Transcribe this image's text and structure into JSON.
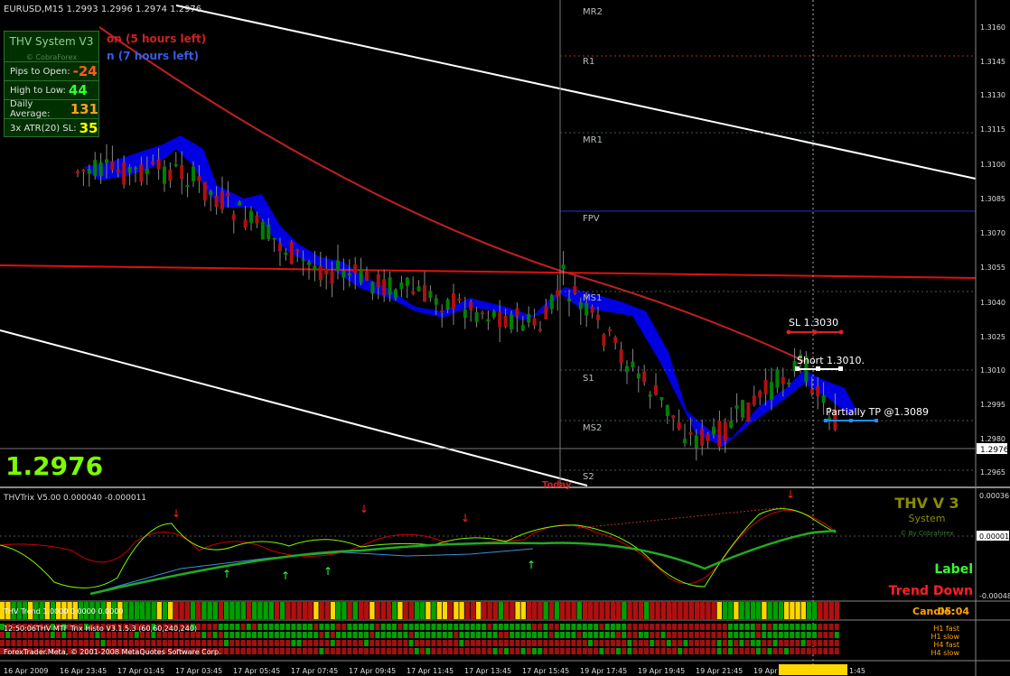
{
  "symbol_header": "EURUSD,M15  1.2993 1.2996 1.2974 1.2976",
  "current_price_big": "1.2976",
  "current_price_tag": "1.2976",
  "overlay_texts": {
    "red_session": "on (5 hours left)",
    "blue_session": "n (7 hours left)"
  },
  "info_panel": {
    "title": "THV System V3",
    "subtitle": "© CobraForex",
    "rows": [
      {
        "label": "Pips to Open:",
        "value": "-24",
        "color": "#ff5a1e"
      },
      {
        "label": "High to Low:",
        "value": "44",
        "color": "#32ff32"
      },
      {
        "label": "Daily Average:",
        "value": "131",
        "color": "#ffa020"
      },
      {
        "label": "3x ATR(20) SL:",
        "value": "35",
        "color": "#ffff00"
      }
    ]
  },
  "pivot_labels": [
    "MR2",
    "R1",
    "MR1",
    "FPV",
    "MS1",
    "S1",
    "MS2",
    "S2"
  ],
  "trade_labels": {
    "sl": "SL 1.3030",
    "short": "Short 1.3010.",
    "tp": "Partially TP @1.3089"
  },
  "today_label": "Today",
  "price_axis": [
    "1.3160",
    "1.3145",
    "1.3130",
    "1.3115",
    "1.3100",
    "1.3085",
    "1.3070",
    "1.3055",
    "1.3040",
    "1.3025",
    "1.3010",
    "1.2995",
    "1.2980",
    "1.2965"
  ],
  "indicator": {
    "title": "THVTrix V5.00 0.000040 -0.000011",
    "axis_top": "0.00036",
    "axis_mid": "0.00001",
    "axis_bottom": "-0.00048",
    "brand_title": "THV V 3",
    "brand_sub": "System",
    "brand_credit": "© By Cobraforex",
    "label": "Label",
    "trend": "Trend Down"
  },
  "trend_bar": {
    "title": "THV Trend 1.0000 0.0000 0.0000",
    "candle_label": "Candle:",
    "candle_time": "05:04"
  },
  "mtf": {
    "title": "12:50:06THV MTF Trix Histo V3.1.5.3 (60,60,240,240)",
    "copyright": "ForexTrader.Meta, © 2001-2008 MetaQuotes Software Corp.",
    "legend": [
      "H1 fast",
      "H1 slow",
      "H4 fast",
      "H4 slow"
    ]
  },
  "time_axis": [
    "16 Apr 2009",
    "16 Apr 23:45",
    "17 Apr 01:45",
    "17 Apr 03:45",
    "17 Apr 05:45",
    "17 Apr 07:45",
    "17 Apr 09:45",
    "17 Apr 11:45",
    "17 Apr 13:45",
    "17 Apr 15:45",
    "19 Apr 17:45",
    "19 Apr 19:45",
    "19 Apr 21:45",
    "19 Apr",
    "2009.04.20 01:45",
    "1:45"
  ],
  "colors": {
    "bull": "#008000",
    "bear": "#b01010",
    "cloud": "#0000e0",
    "ma": "#d02020",
    "trix_fast": "#00c000",
    "trix_slow": "#d00000",
    "accent_yellow": "#ffd700"
  }
}
